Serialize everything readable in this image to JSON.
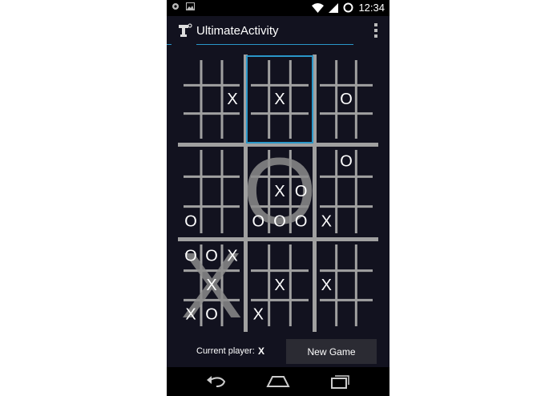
{
  "status_bar": {
    "time": "12:34"
  },
  "action_bar": {
    "title": "UltimateActivity"
  },
  "board": {
    "active_board": 1,
    "boards": [
      {
        "winner": "",
        "cells": [
          "",
          "",
          "",
          "",
          "",
          "X",
          "",
          "",
          ""
        ]
      },
      {
        "winner": "",
        "cells": [
          "",
          "",
          "",
          "",
          "X",
          "",
          "",
          "",
          ""
        ]
      },
      {
        "winner": "",
        "cells": [
          "",
          "",
          "",
          "",
          "O",
          "",
          "",
          "",
          ""
        ]
      },
      {
        "winner": "",
        "cells": [
          "",
          "",
          "",
          "",
          "",
          "",
          "O",
          "",
          ""
        ]
      },
      {
        "winner": "O",
        "cells": [
          "",
          "",
          "",
          "",
          "X",
          "O",
          "O",
          "O",
          "O"
        ]
      },
      {
        "winner": "",
        "cells": [
          "",
          "O",
          "",
          "",
          "",
          "",
          "X",
          "",
          ""
        ]
      },
      {
        "winner": "X",
        "cells": [
          "O",
          "O",
          "X",
          "",
          "X",
          "",
          "X",
          "O",
          ""
        ]
      },
      {
        "winner": "",
        "cells": [
          "",
          "",
          "",
          "",
          "X",
          "",
          "X",
          "",
          ""
        ]
      },
      {
        "winner": "",
        "cells": [
          "",
          "",
          "",
          "X",
          "",
          "",
          "",
          "",
          ""
        ]
      }
    ]
  },
  "footer": {
    "current_player_label": "Current player:",
    "current_player": "X",
    "new_game_label": "New Game"
  },
  "colors": {
    "background": "#12121f",
    "grid": "#a0a0a0",
    "active_highlight": "#2a97c9",
    "mark": "#ffffff",
    "big_mark": "#8c8c8c"
  }
}
